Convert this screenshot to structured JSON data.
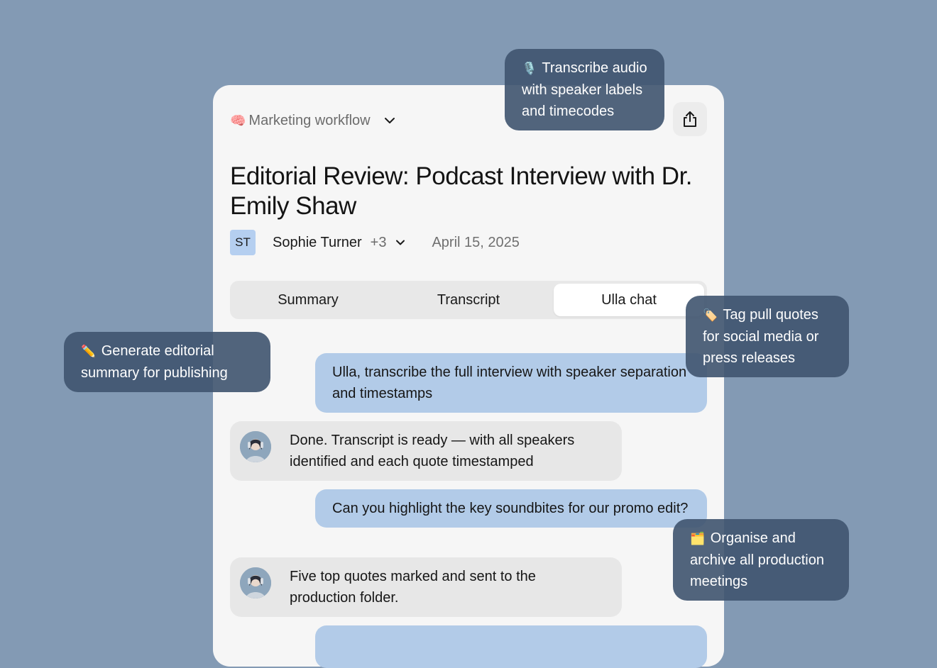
{
  "workflow": {
    "emoji": "🧠",
    "label": "Marketing workflow",
    "chevron_icon": "chevron-down-icon"
  },
  "share": {
    "icon": "share-icon"
  },
  "document": {
    "title": "Editorial Review: Podcast Interview with Dr. Emily Shaw",
    "author_initials": "ST",
    "author_name": "Sophie Turner",
    "extra_participants": "+3",
    "date": "April 15, 2025"
  },
  "tabs": [
    {
      "label": "Summary",
      "active": false
    },
    {
      "label": "Transcript",
      "active": false
    },
    {
      "label": "Ulla chat",
      "active": true
    }
  ],
  "chat": [
    {
      "role": "user",
      "text": "Ulla, transcribe the full interview with speaker separation and timestamps"
    },
    {
      "role": "assistant",
      "text": "Done. Transcript is ready — with all speakers identified and each quote timestamped"
    },
    {
      "role": "user",
      "text": "Can you highlight the key soundbites for our promo edit?"
    },
    {
      "role": "assistant",
      "text": "Five top quotes marked and sent to the production folder."
    }
  ],
  "features": [
    {
      "emoji": "🎙️",
      "text": "Transcribe audio with speaker labels and timecodes"
    },
    {
      "emoji": "🏷️",
      "text": "Tag pull quotes for social media or press releases"
    },
    {
      "emoji": "✏️",
      "text": "Generate editorial summary for publishing"
    },
    {
      "emoji": "🗂️",
      "text": "Organise and archive all production meetings"
    }
  ],
  "colors": {
    "background": "#839ab4",
    "card": "#f6f6f6",
    "user_bubble": "#b2cbe8",
    "assistant_bubble": "#e7e7e7",
    "tooltip": "#3f546f",
    "avatar": "#b5cff0"
  }
}
